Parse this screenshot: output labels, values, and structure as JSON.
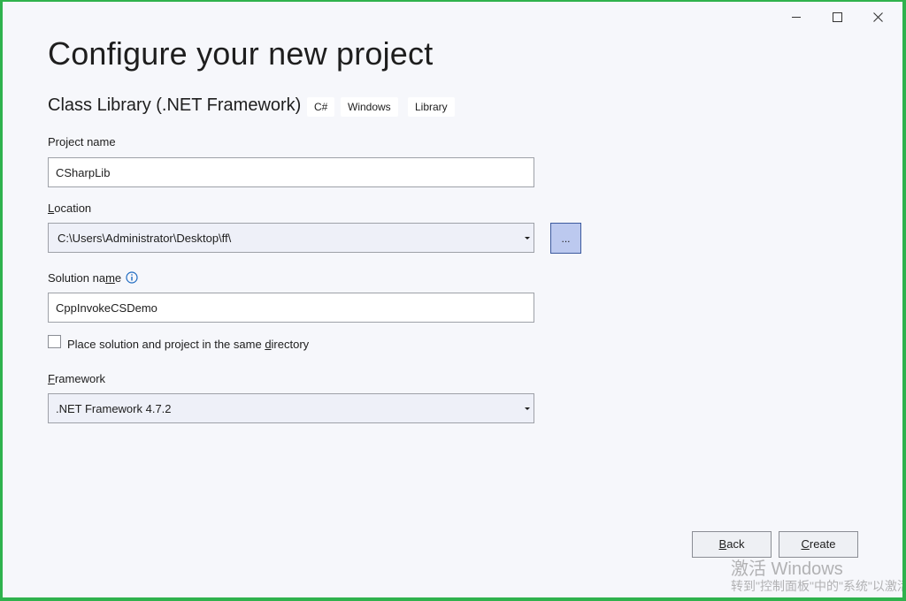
{
  "window": {
    "title": "Configure your new project",
    "controls": [
      "minimize",
      "maximize",
      "close"
    ]
  },
  "template": {
    "name": "Class Library (.NET Framework)",
    "tags": [
      "C#",
      "Windows",
      "Library"
    ]
  },
  "project_name": {
    "label": "Project name",
    "value": "CSharpLib"
  },
  "location": {
    "label": "Location",
    "value": "C:\\Users\\Administrator\\Desktop\\ff\\",
    "browse_label": "..."
  },
  "solution_name": {
    "label": "Solution name",
    "value": "CppInvokeCSDemo",
    "info_icon": "info-icon"
  },
  "same_directory": {
    "label": "Place solution and project in the same directory",
    "checked": false
  },
  "framework": {
    "label": "Framework",
    "value": ".NET Framework 4.7.2"
  },
  "buttons": {
    "back": "Back",
    "create": "Create"
  },
  "watermark": {
    "line1": "激活 Windows",
    "line2": "转到\"控制面板\"中的\"系统\"以激活 Windows。"
  },
  "colors": {
    "window_border": "#2fb24d",
    "background": "#f6f7fb",
    "browse_button": "#bcc9ef"
  }
}
